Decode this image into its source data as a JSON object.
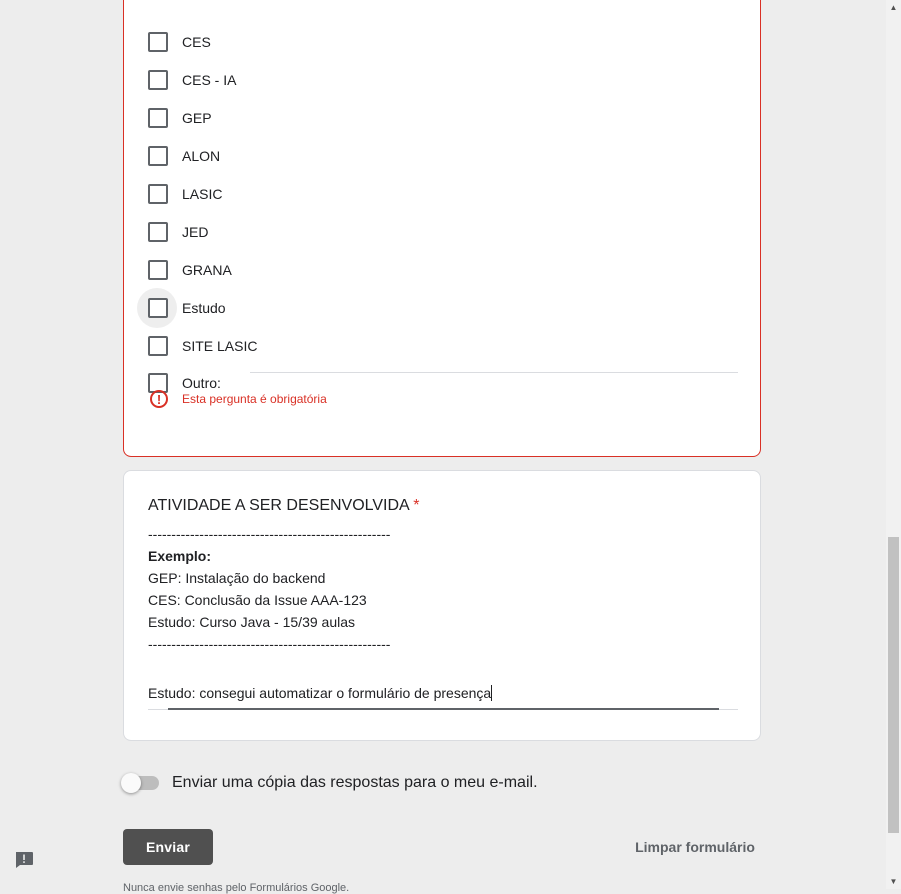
{
  "checkbox_question": {
    "options": [
      "CES",
      "CES - IA",
      "GEP",
      "ALON",
      "LASIC",
      "JED",
      "GRANA",
      "Estudo",
      "SITE LASIC"
    ],
    "other_label": "Outro:",
    "error_text": "Esta pergunta é obrigatória",
    "error_icon": "!"
  },
  "activity_question": {
    "title": "ATIVIDADE A SER DESENVOLVIDA",
    "required_mark": "*",
    "separator": "----------------------------------------------------",
    "example_label": "Exemplo:",
    "examples": [
      "GEP: Instalação do backend",
      "CES: Conclusão da Issue AAA-123",
      "Estudo: Curso Java - 15/39 aulas"
    ],
    "answer_value": "Estudo: consegui automatizar o formulário de presença"
  },
  "email_copy": {
    "label": "Enviar uma cópia das respostas para o meu e-mail.",
    "enabled": false
  },
  "actions": {
    "submit_label": "Enviar",
    "clear_label": "Limpar formulário"
  },
  "footer": {
    "note": "Nunca envie senhas pelo Formulários Google."
  },
  "colors": {
    "error": "#d93025",
    "submit_bg": "#505050",
    "page_bg": "#ededed"
  }
}
